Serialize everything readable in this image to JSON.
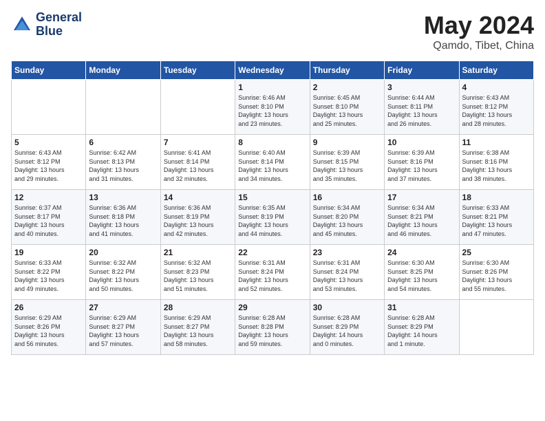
{
  "header": {
    "logo_line1": "General",
    "logo_line2": "Blue",
    "month_year": "May 2024",
    "location": "Qamdo, Tibet, China"
  },
  "days_of_week": [
    "Sunday",
    "Monday",
    "Tuesday",
    "Wednesday",
    "Thursday",
    "Friday",
    "Saturday"
  ],
  "weeks": [
    [
      {
        "day": "",
        "info": ""
      },
      {
        "day": "",
        "info": ""
      },
      {
        "day": "",
        "info": ""
      },
      {
        "day": "1",
        "info": "Sunrise: 6:46 AM\nSunset: 8:10 PM\nDaylight: 13 hours\nand 23 minutes."
      },
      {
        "day": "2",
        "info": "Sunrise: 6:45 AM\nSunset: 8:10 PM\nDaylight: 13 hours\nand 25 minutes."
      },
      {
        "day": "3",
        "info": "Sunrise: 6:44 AM\nSunset: 8:11 PM\nDaylight: 13 hours\nand 26 minutes."
      },
      {
        "day": "4",
        "info": "Sunrise: 6:43 AM\nSunset: 8:12 PM\nDaylight: 13 hours\nand 28 minutes."
      }
    ],
    [
      {
        "day": "5",
        "info": "Sunrise: 6:43 AM\nSunset: 8:12 PM\nDaylight: 13 hours\nand 29 minutes."
      },
      {
        "day": "6",
        "info": "Sunrise: 6:42 AM\nSunset: 8:13 PM\nDaylight: 13 hours\nand 31 minutes."
      },
      {
        "day": "7",
        "info": "Sunrise: 6:41 AM\nSunset: 8:14 PM\nDaylight: 13 hours\nand 32 minutes."
      },
      {
        "day": "8",
        "info": "Sunrise: 6:40 AM\nSunset: 8:14 PM\nDaylight: 13 hours\nand 34 minutes."
      },
      {
        "day": "9",
        "info": "Sunrise: 6:39 AM\nSunset: 8:15 PM\nDaylight: 13 hours\nand 35 minutes."
      },
      {
        "day": "10",
        "info": "Sunrise: 6:39 AM\nSunset: 8:16 PM\nDaylight: 13 hours\nand 37 minutes."
      },
      {
        "day": "11",
        "info": "Sunrise: 6:38 AM\nSunset: 8:16 PM\nDaylight: 13 hours\nand 38 minutes."
      }
    ],
    [
      {
        "day": "12",
        "info": "Sunrise: 6:37 AM\nSunset: 8:17 PM\nDaylight: 13 hours\nand 40 minutes."
      },
      {
        "day": "13",
        "info": "Sunrise: 6:36 AM\nSunset: 8:18 PM\nDaylight: 13 hours\nand 41 minutes."
      },
      {
        "day": "14",
        "info": "Sunrise: 6:36 AM\nSunset: 8:19 PM\nDaylight: 13 hours\nand 42 minutes."
      },
      {
        "day": "15",
        "info": "Sunrise: 6:35 AM\nSunset: 8:19 PM\nDaylight: 13 hours\nand 44 minutes."
      },
      {
        "day": "16",
        "info": "Sunrise: 6:34 AM\nSunset: 8:20 PM\nDaylight: 13 hours\nand 45 minutes."
      },
      {
        "day": "17",
        "info": "Sunrise: 6:34 AM\nSunset: 8:21 PM\nDaylight: 13 hours\nand 46 minutes."
      },
      {
        "day": "18",
        "info": "Sunrise: 6:33 AM\nSunset: 8:21 PM\nDaylight: 13 hours\nand 47 minutes."
      }
    ],
    [
      {
        "day": "19",
        "info": "Sunrise: 6:33 AM\nSunset: 8:22 PM\nDaylight: 13 hours\nand 49 minutes."
      },
      {
        "day": "20",
        "info": "Sunrise: 6:32 AM\nSunset: 8:22 PM\nDaylight: 13 hours\nand 50 minutes."
      },
      {
        "day": "21",
        "info": "Sunrise: 6:32 AM\nSunset: 8:23 PM\nDaylight: 13 hours\nand 51 minutes."
      },
      {
        "day": "22",
        "info": "Sunrise: 6:31 AM\nSunset: 8:24 PM\nDaylight: 13 hours\nand 52 minutes."
      },
      {
        "day": "23",
        "info": "Sunrise: 6:31 AM\nSunset: 8:24 PM\nDaylight: 13 hours\nand 53 minutes."
      },
      {
        "day": "24",
        "info": "Sunrise: 6:30 AM\nSunset: 8:25 PM\nDaylight: 13 hours\nand 54 minutes."
      },
      {
        "day": "25",
        "info": "Sunrise: 6:30 AM\nSunset: 8:26 PM\nDaylight: 13 hours\nand 55 minutes."
      }
    ],
    [
      {
        "day": "26",
        "info": "Sunrise: 6:29 AM\nSunset: 8:26 PM\nDaylight: 13 hours\nand 56 minutes."
      },
      {
        "day": "27",
        "info": "Sunrise: 6:29 AM\nSunset: 8:27 PM\nDaylight: 13 hours\nand 57 minutes."
      },
      {
        "day": "28",
        "info": "Sunrise: 6:29 AM\nSunset: 8:27 PM\nDaylight: 13 hours\nand 58 minutes."
      },
      {
        "day": "29",
        "info": "Sunrise: 6:28 AM\nSunset: 8:28 PM\nDaylight: 13 hours\nand 59 minutes."
      },
      {
        "day": "30",
        "info": "Sunrise: 6:28 AM\nSunset: 8:29 PM\nDaylight: 14 hours\nand 0 minutes."
      },
      {
        "day": "31",
        "info": "Sunrise: 6:28 AM\nSunset: 8:29 PM\nDaylight: 14 hours\nand 1 minute."
      },
      {
        "day": "",
        "info": ""
      }
    ]
  ]
}
